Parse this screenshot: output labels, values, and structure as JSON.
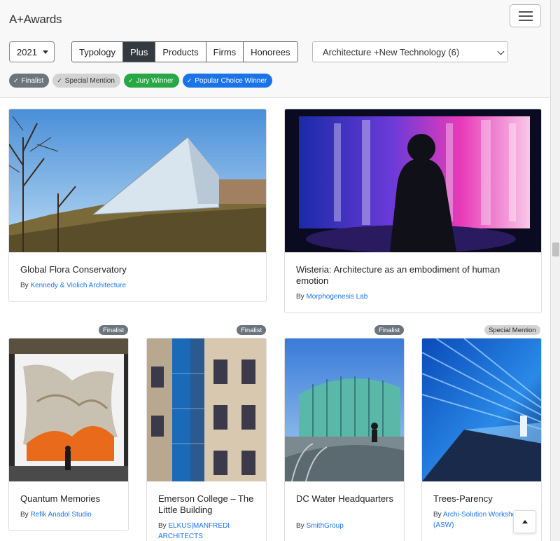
{
  "header": {
    "brand": "A+Awards",
    "year": "2021",
    "tabs": [
      {
        "label": "Typology",
        "active": false
      },
      {
        "label": "Plus",
        "active": true
      },
      {
        "label": "Products",
        "active": false
      },
      {
        "label": "Firms",
        "active": false
      },
      {
        "label": "Honorees",
        "active": false
      }
    ],
    "category": "Architecture +New Technology (6)",
    "filters": {
      "finalist": "Finalist",
      "special": "Special Mention",
      "jury": "Jury Winner",
      "popular": "Popular Choice Winner"
    }
  },
  "entries": [
    {
      "title": "Global Flora Conservatory",
      "by_prefix": "By",
      "firm": "Kennedy & Violich Architecture",
      "badge": ""
    },
    {
      "title": "Wisteria: Architecture as an embodiment of human emotion",
      "by_prefix": "By",
      "firm": "Morphogenesis Lab",
      "badge": ""
    },
    {
      "title": "Quantum Memories",
      "by_prefix": "By",
      "firm": "Refik Anadol Studio",
      "badge": "Finalist"
    },
    {
      "title": "Emerson College – The Little Building",
      "by_prefix": "By",
      "firm": "ELKUS|MANFREDI ARCHITECTS",
      "badge": "Finalist"
    },
    {
      "title": "DC Water Headquarters",
      "by_prefix": "By",
      "firm": "SmithGroup",
      "badge": "Finalist"
    },
    {
      "title": "Trees-Parency",
      "by_prefix": "By",
      "firm": "Archi-Solution Workshop (ASW)",
      "badge": "Special Mention"
    }
  ],
  "colors": {
    "accent": "#1a73e8",
    "active_tab": "#343a40",
    "finalist": "#6c757d",
    "jury": "#28a745"
  },
  "icons": {
    "menu": "hamburger-menu-icon",
    "check": "check-icon",
    "back_to_top": "arrow-up-icon"
  }
}
